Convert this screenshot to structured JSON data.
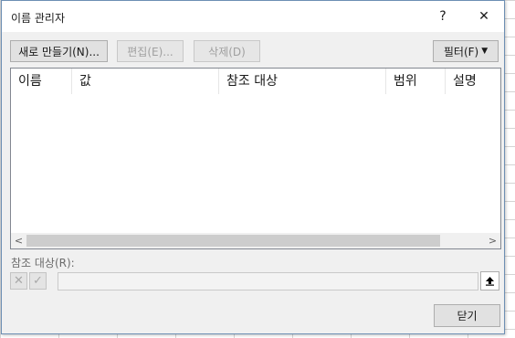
{
  "dialog": {
    "title": "이름 관리자",
    "help_glyph": "?",
    "close_glyph": "✕"
  },
  "toolbar": {
    "new_label": "새로 만들기(N)...",
    "edit_label": "편집(E)...",
    "delete_label": "삭제(D)",
    "filter_label": "필터(F)",
    "filter_caret": "▼"
  },
  "list": {
    "columns": [
      "이름",
      "값",
      "참조 대상",
      "범위",
      "설명"
    ],
    "rows": []
  },
  "scrollbar": {
    "left_arrow": "<",
    "right_arrow": ">"
  },
  "refers_to": {
    "label": "참조 대상(R):",
    "value": "",
    "cancel_glyph": "✕",
    "confirm_glyph": "✓"
  },
  "footer": {
    "close_label": "닫기"
  },
  "icons": {
    "help": "question-icon",
    "close": "close-icon",
    "collapse": "collapse-dialog-icon"
  },
  "colors": {
    "dialog_border": "#6d8fb4",
    "button_face": "#e1e1e1",
    "scroll_thumb": "#cdcdcd"
  }
}
